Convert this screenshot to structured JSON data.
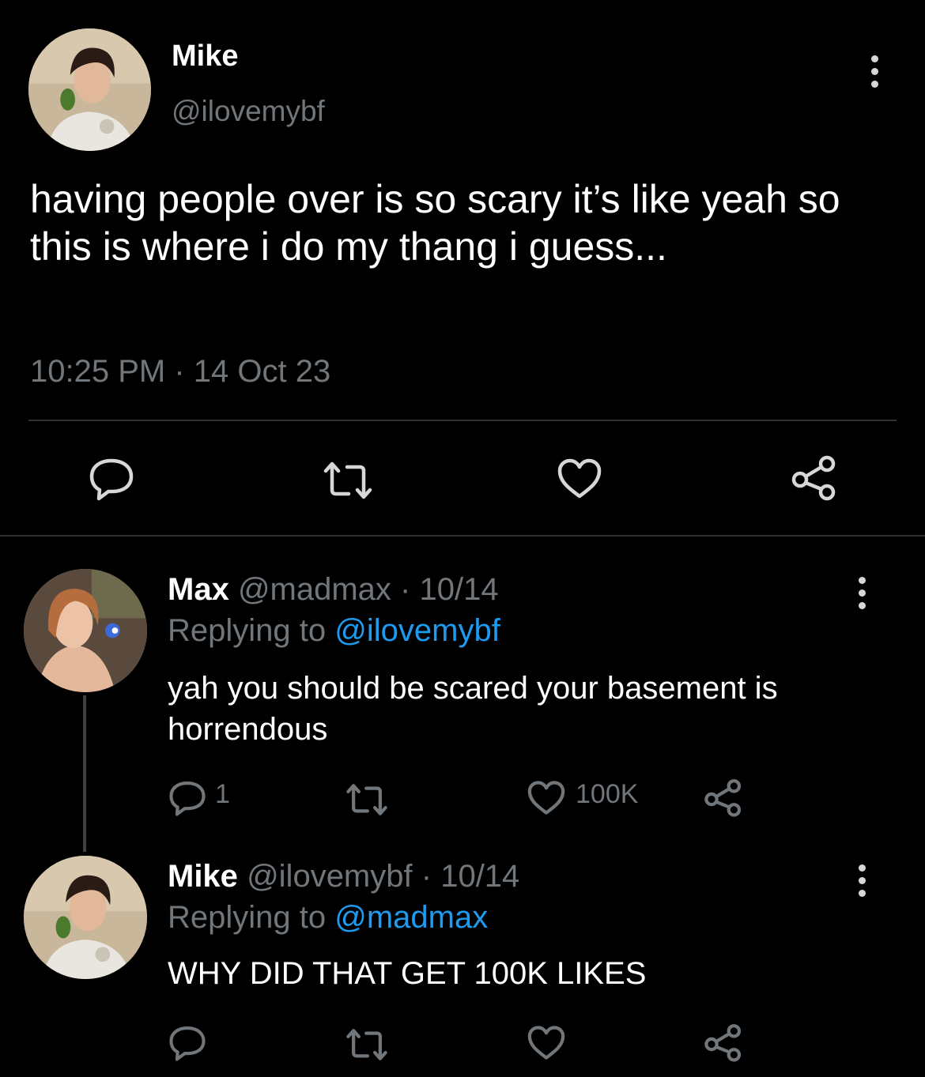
{
  "main_tweet": {
    "display_name": "Mike",
    "handle": "@ilovemybf",
    "text": "having people over is so scary it’s like yeah so this is where i do my thang i guess...",
    "time": "10:25 PM",
    "separator": "·",
    "date": "14 Oct 23",
    "icons": [
      "reply-icon",
      "retweet-icon",
      "like-icon",
      "share-icon"
    ]
  },
  "replies": [
    {
      "display_name": "Max",
      "handle": "@madmax",
      "dot": "·",
      "date": "10/14",
      "replying_prefix": "Replying to",
      "replying_to": "@ilovemybf",
      "text": "yah you should be scared your basement is horrendous",
      "reply_count": "1",
      "like_count": "100K"
    },
    {
      "display_name": "Mike",
      "handle": "@ilovemybf",
      "dot": "·",
      "date": "10/14",
      "replying_prefix": "Replying to",
      "replying_to": "@madmax",
      "text": "WHY DID THAT GET 100K LIKES",
      "reply_count": "",
      "like_count": ""
    }
  ],
  "colors": {
    "background": "#000000",
    "text": "#ffffff",
    "secondary": "#71767b",
    "link": "#1d9bf0",
    "divider": "#2f3336"
  }
}
